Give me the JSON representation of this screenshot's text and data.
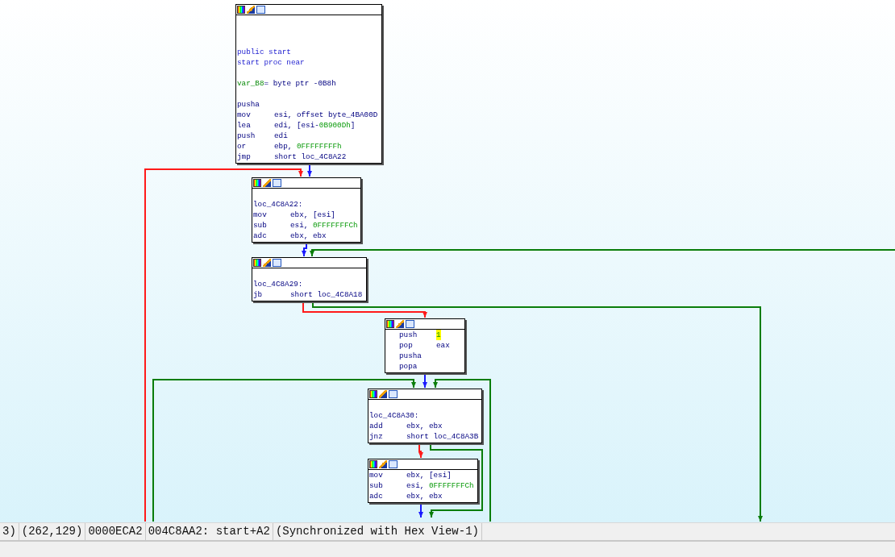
{
  "graph": {
    "nodes": [
      {
        "indented": false,
        "lines": [
          {
            "kind": "blank"
          },
          {
            "kind": "blank"
          },
          {
            "kind": "blank"
          },
          {
            "kind": "directive",
            "text": "public start"
          },
          {
            "kind": "directive",
            "text": "start proc near"
          },
          {
            "kind": "blank"
          },
          {
            "kind": "segments",
            "segments": [
              {
                "text": "var_B8",
                "kind": "var"
              },
              {
                "text": "= byte ptr -0B8h",
                "kind": "plain"
              }
            ]
          },
          {
            "kind": "blank"
          },
          {
            "kind": "instr",
            "mnemonic": "pusha"
          },
          {
            "kind": "instr",
            "mnemonic": "mov",
            "operands": [
              {
                "text": "esi, offset byte_4BA00D",
                "kind": "plain"
              }
            ]
          },
          {
            "kind": "instr",
            "mnemonic": "lea",
            "operands": [
              {
                "text": "edi, [esi-",
                "kind": "plain"
              },
              {
                "text": "0B900Dh",
                "kind": "number"
              },
              {
                "text": "]",
                "kind": "plain"
              }
            ]
          },
          {
            "kind": "instr",
            "mnemonic": "push",
            "operands": [
              {
                "text": "edi",
                "kind": "plain"
              }
            ]
          },
          {
            "kind": "instr",
            "mnemonic": "or",
            "operands": [
              {
                "text": "ebp, ",
                "kind": "plain"
              },
              {
                "text": "0FFFFFFFFh",
                "kind": "number"
              }
            ]
          },
          {
            "kind": "instr",
            "mnemonic": "jmp",
            "operands": [
              {
                "text": "short loc_4C8A22",
                "kind": "plain"
              }
            ]
          }
        ]
      },
      {
        "indented": false,
        "lines": [
          {
            "kind": "blank"
          },
          {
            "kind": "label",
            "text": "loc_4C8A22:"
          },
          {
            "kind": "instr",
            "mnemonic": "mov",
            "operands": [
              {
                "text": "ebx, [esi]",
                "kind": "plain"
              }
            ]
          },
          {
            "kind": "instr",
            "mnemonic": "sub",
            "operands": [
              {
                "text": "esi, ",
                "kind": "plain"
              },
              {
                "text": "0FFFFFFFCh",
                "kind": "number"
              }
            ]
          },
          {
            "kind": "instr",
            "mnemonic": "adc",
            "operands": [
              {
                "text": "ebx, ebx",
                "kind": "plain"
              }
            ]
          }
        ]
      },
      {
        "indented": false,
        "lines": [
          {
            "kind": "blank"
          },
          {
            "kind": "label",
            "text": "loc_4C8A29:"
          },
          {
            "kind": "instr",
            "mnemonic": "jb",
            "operands": [
              {
                "text": "short loc_4C8A18",
                "kind": "plain"
              }
            ]
          }
        ]
      },
      {
        "indented": true,
        "lines": [
          {
            "kind": "instr",
            "mnemonic": "push",
            "operands": [
              {
                "text": "1",
                "kind": "highlighted"
              }
            ]
          },
          {
            "kind": "instr",
            "mnemonic": "pop",
            "operands": [
              {
                "text": "eax",
                "kind": "plain"
              }
            ]
          },
          {
            "kind": "instr",
            "mnemonic": "pusha"
          },
          {
            "kind": "instr",
            "mnemonic": "popa"
          }
        ]
      },
      {
        "indented": false,
        "lines": [
          {
            "kind": "blank"
          },
          {
            "kind": "label",
            "text": "loc_4C8A30:"
          },
          {
            "kind": "instr",
            "mnemonic": "add",
            "operands": [
              {
                "text": "ebx, ebx",
                "kind": "plain"
              }
            ]
          },
          {
            "kind": "instr",
            "mnemonic": "jnz",
            "operands": [
              {
                "text": "short loc_4C8A3B",
                "kind": "plain"
              }
            ]
          }
        ]
      },
      {
        "indented": false,
        "lines": [
          {
            "kind": "instr",
            "mnemonic": "mov",
            "operands": [
              {
                "text": "ebx, [esi]",
                "kind": "plain"
              }
            ]
          },
          {
            "kind": "instr",
            "mnemonic": "sub",
            "operands": [
              {
                "text": "esi, ",
                "kind": "plain"
              },
              {
                "text": "0FFFFFFFCh",
                "kind": "number"
              }
            ]
          },
          {
            "kind": "instr",
            "mnemonic": "adc",
            "operands": [
              {
                "text": "ebx, ebx",
                "kind": "plain"
              }
            ]
          }
        ]
      }
    ],
    "edges": [
      {
        "kind": "flow"
      },
      {
        "kind": "false"
      },
      {
        "kind": "flow"
      },
      {
        "kind": "true"
      },
      {
        "kind": "false"
      },
      {
        "kind": "true"
      },
      {
        "kind": "flow"
      },
      {
        "kind": "true"
      },
      {
        "kind": "true"
      },
      {
        "kind": "false"
      },
      {
        "kind": "true"
      },
      {
        "kind": "flow"
      }
    ]
  },
  "status_bar": [
    "3)",
    "(262,129)",
    "0000ECA2",
    "004C8AA2: start+A2",
    "(Synchronized with Hex View-1)"
  ]
}
